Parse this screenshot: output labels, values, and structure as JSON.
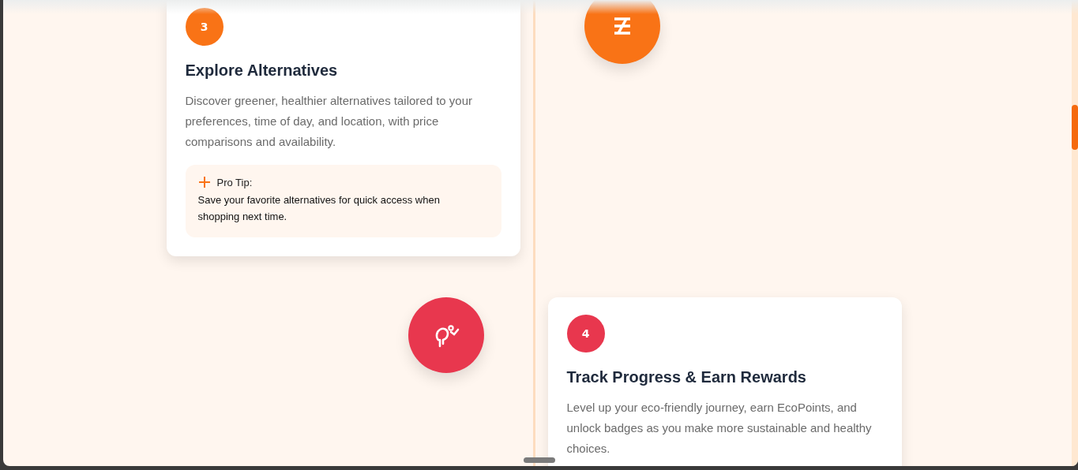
{
  "steps": [
    {
      "number": "3",
      "title": "Explore Alternatives",
      "description": "Discover greener, healthier alternatives tailored to your preferences, time of day, and location, with price comparisons and availability.",
      "color": "#f97316",
      "tip": {
        "label": "Pro Tip:",
        "text": "Save your favorite alternatives for quick access when shopping next time."
      }
    },
    {
      "number": "4",
      "title": "Track Progress & Earn Rewards",
      "description": "Level up your eco-friendly journey, earn EcoPoints, and unlock badges as you make more sustainable and healthy choices.",
      "color": "#e8374e"
    }
  ]
}
